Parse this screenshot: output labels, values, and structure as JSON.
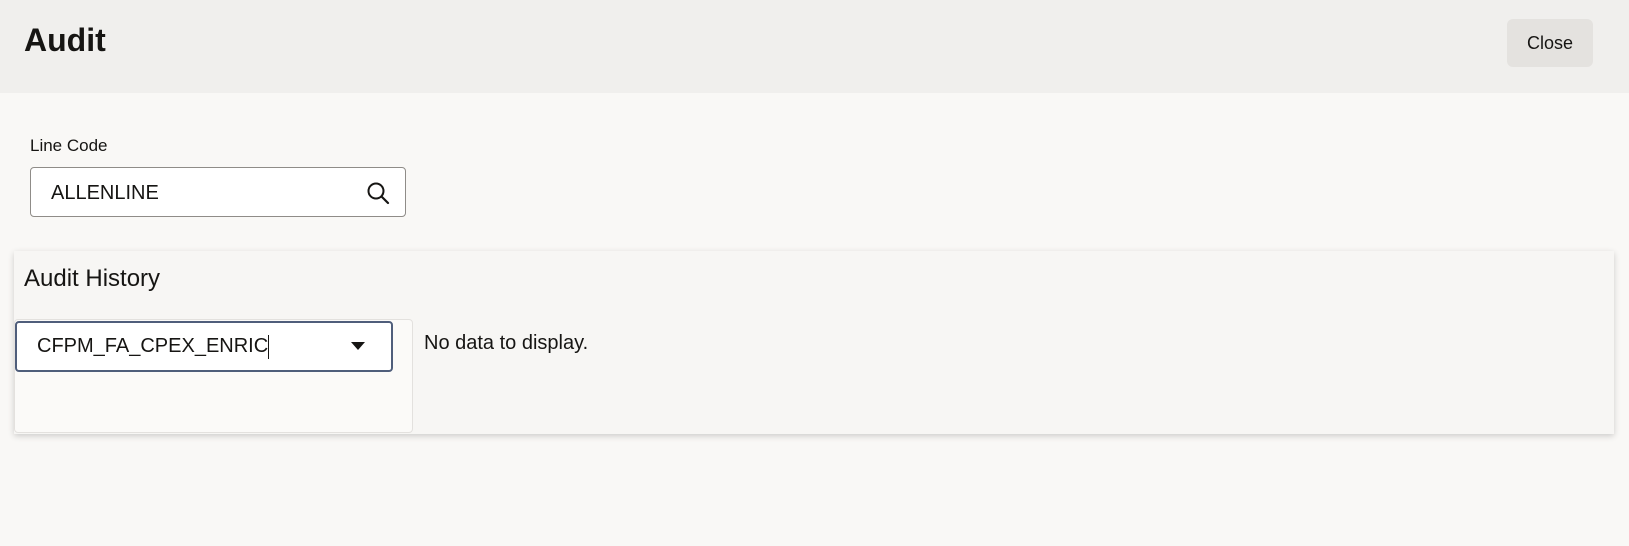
{
  "header": {
    "title": "Audit",
    "close_label": "Close"
  },
  "line_code": {
    "label": "Line Code",
    "value": "ALLENLINE",
    "icon": "search-icon"
  },
  "audit_history": {
    "title": "Audit History",
    "selector": {
      "value": "CFPM_FA_CPEX_ENRIC",
      "icon": "chevron-down-icon"
    },
    "empty_message": "No data to display."
  },
  "colors": {
    "header_bg": "#f0efed",
    "page_bg": "#f9f8f6",
    "focus_border": "#4f5e7b",
    "button_bg": "#e4e2df"
  }
}
